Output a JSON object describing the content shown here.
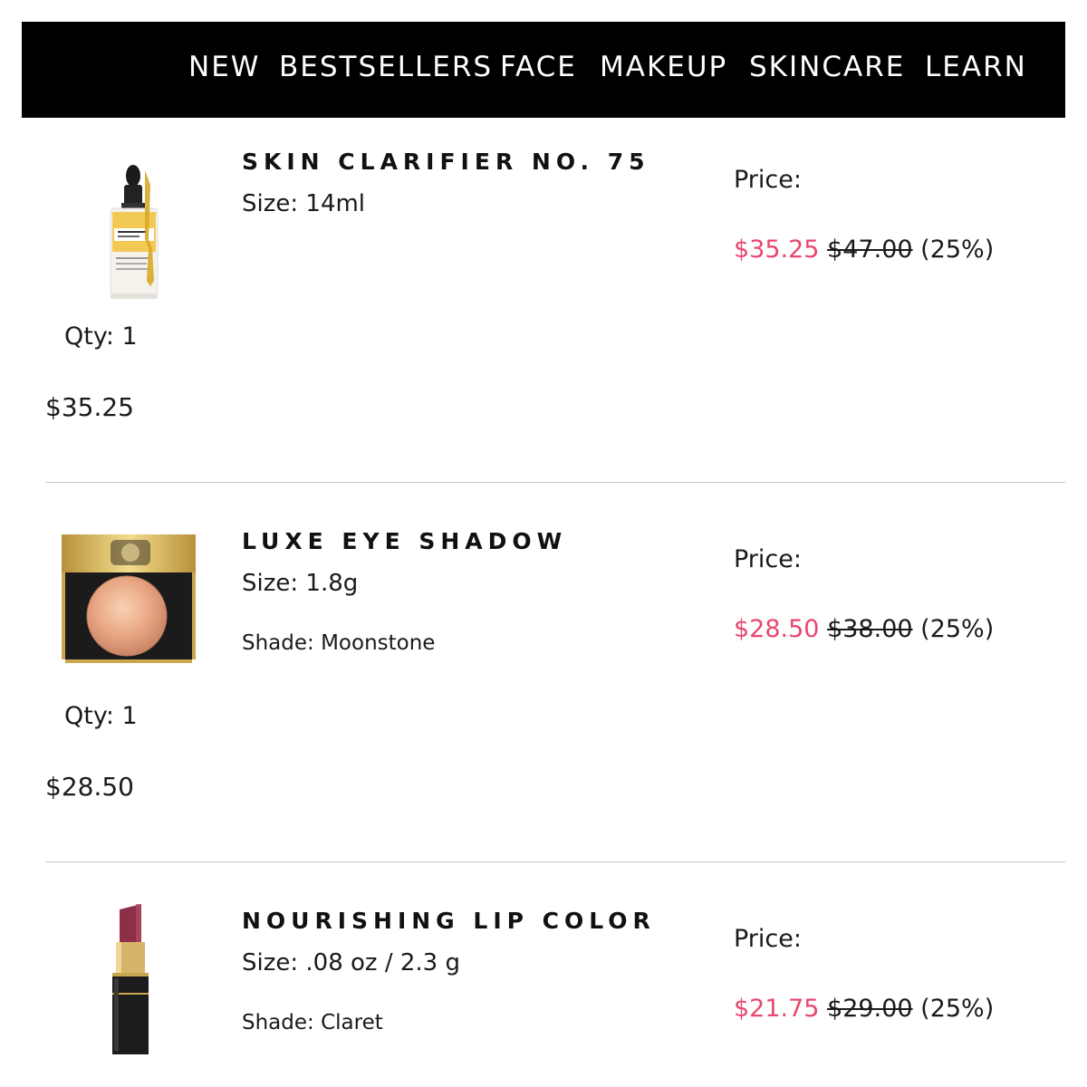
{
  "nav": {
    "items": [
      "NEW",
      "BESTSELLERS",
      "FACE",
      "MAKEUP",
      "SKINCARE",
      "LEARN"
    ]
  },
  "cart_items": [
    {
      "name": "SKIN CLARIFIER NO. 75",
      "size": "Size: 14ml",
      "shade": "",
      "qty": "Qty: 1",
      "line_total": "$35.25",
      "price_label": "Price:",
      "sale_price": "$35.25",
      "original_price": "$47.00",
      "discount": "(25%)",
      "image_icon": "dropper-serum-bottle-icon"
    },
    {
      "name": "LUXE EYE SHADOW",
      "size": "Size: 1.8g",
      "shade": "Shade: Moonstone",
      "qty": "Qty: 1",
      "line_total": "$28.50",
      "price_label": "Price:",
      "sale_price": "$28.50",
      "original_price": "$38.00",
      "discount": "(25%)",
      "image_icon": "eyeshadow-compact-icon"
    },
    {
      "name": "NOURISHING LIP COLOR",
      "size": "Size: .08 oz / 2.3 g",
      "shade": "Shade: Claret",
      "qty": "",
      "line_total": "",
      "price_label": "Price:",
      "sale_price": "$21.75",
      "original_price": "$29.00",
      "discount": "(25%)",
      "image_icon": "lipstick-icon"
    }
  ],
  "colors": {
    "nav_background": "#000000",
    "sale_price": "#e8476f",
    "text": "#1a1a1a",
    "divider": "#c8c8c8"
  }
}
